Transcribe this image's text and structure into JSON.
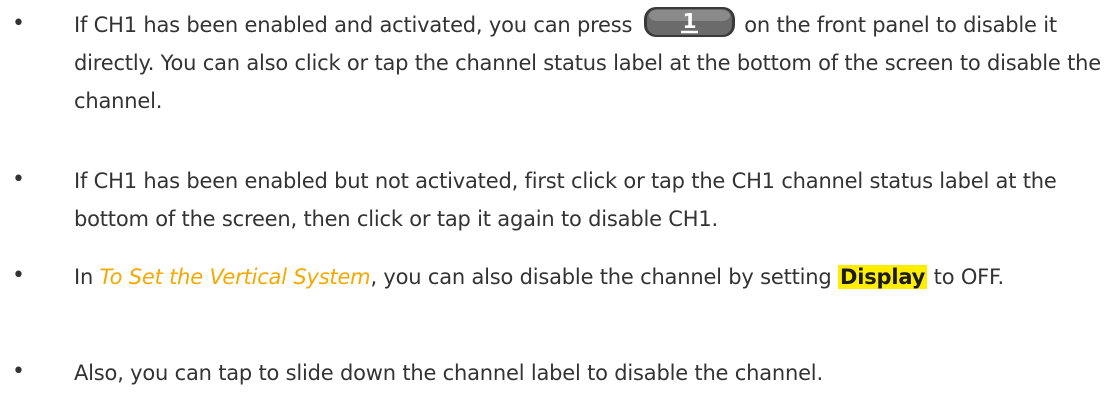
{
  "bullets": [
    {
      "marker": "•",
      "text_before": "If CH1 has been enabled and activated, you can press ",
      "key_label": "1",
      "text_after": " on the front panel to disable it directly. You can also click or tap the channel status label at the bottom of the screen to disable the channel."
    },
    {
      "marker": "•",
      "text": "If CH1 has been enabled but not activated, first click or tap the CH1 channel status label at the bottom of the screen, then click or tap it again to disable CH1."
    },
    {
      "marker": "•",
      "text_before": "In ",
      "link_text": "To Set the Vertical System",
      "text_middle": ", you can also disable the channel by setting ",
      "highlight_text": "Display",
      "text_after": " to OFF."
    },
    {
      "marker": "•",
      "text": "Also, you can tap to slide down the channel label to disable the channel."
    }
  ],
  "icons": {
    "key": "channel-1-key-icon"
  },
  "colors": {
    "body_text": "#333333",
    "link": "#f5a800",
    "highlight_bg": "#ffee00",
    "key_dark": "#3a3a3a",
    "key_face": "#6b6b6b"
  }
}
